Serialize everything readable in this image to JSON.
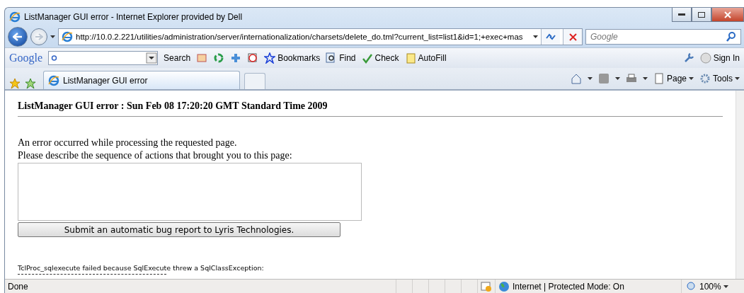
{
  "window": {
    "title": "ListManager GUI error - Internet Explorer provided by Dell"
  },
  "address_bar": {
    "url": "http://10.0.2.221/utilities/administration/server/internationalization/charsets/delete_do.tml?current_list=list1&id=1;+exec+mas"
  },
  "search_box": {
    "placeholder": "Google"
  },
  "google_toolbar": {
    "logo": "Google",
    "search_button": "Search",
    "bookmarks": "Bookmarks",
    "find": "Find",
    "check": "Check",
    "autofill": "AutoFill",
    "sign_in": "Sign In"
  },
  "tab": {
    "title": "ListManager GUI error",
    "selected": true
  },
  "command_bar": {
    "page": "Page",
    "tools": "Tools"
  },
  "content": {
    "heading": "ListManager GUI error : Sun Feb 08 17:20:20 GMT Standard Time 2009",
    "lines": [
      "An error occurred while processing the requested page.",
      "Please describe the sequence of actions that brought you to this page:"
    ],
    "submit_button": "Submit an automatic bug report to Lyris Technologies.",
    "exception": "TclProc_sqlexecute failed because SqlExecute threw a SqlClassException:"
  },
  "status_bar": {
    "status": "Done",
    "zone": "Internet | Protected Mode: On",
    "zoom": "100%"
  }
}
